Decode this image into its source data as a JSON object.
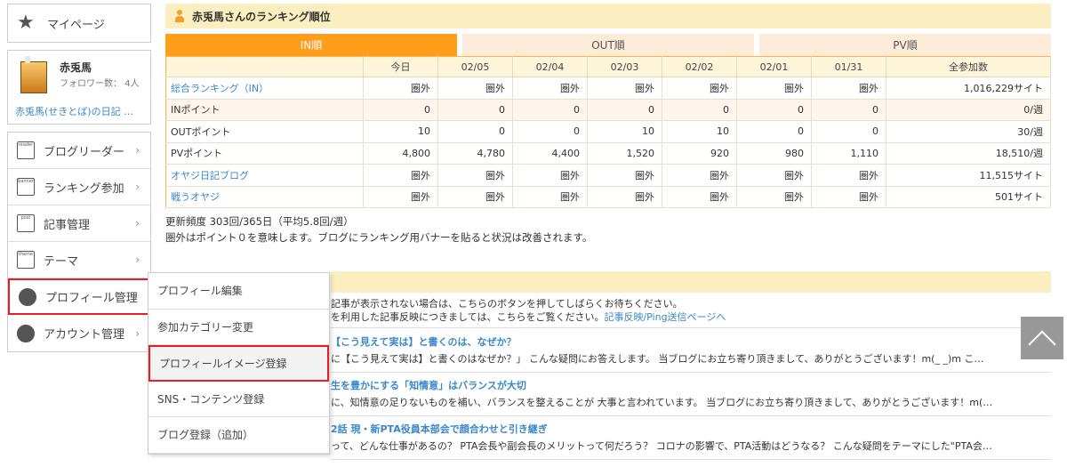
{
  "sidebar": {
    "mypage_label": "マイページ",
    "profile": {
      "name": "赤兎馬",
      "followers": "フォロワー数： 4人",
      "diary": "赤兎馬(せきとば)の日記 …"
    },
    "menu": [
      {
        "label": "ブログリーダー",
        "icon": "reader"
      },
      {
        "label": "ランキング参加",
        "icon": "banner"
      },
      {
        "label": "記事管理",
        "icon": "post"
      },
      {
        "label": "テーマ",
        "icon": "theme"
      },
      {
        "label": "プロフィール管理",
        "icon": "profile"
      },
      {
        "label": "アカウント管理",
        "icon": "gear"
      }
    ]
  },
  "submenu": [
    "プロフィール編集",
    "参加カテゴリー変更",
    "プロフィールイメージ登録",
    "SNS・コンテンツ登録",
    "ブログ登録（追加）"
  ],
  "ranking": {
    "heading": "赤兎馬さんのランキング順位",
    "tabs": [
      "IN順",
      "OUT順",
      "PV順"
    ],
    "columns": [
      "",
      "今日",
      "02/05",
      "02/04",
      "02/03",
      "02/02",
      "02/01",
      "01/31",
      "全参加数"
    ],
    "rows": [
      {
        "label": "総合ランキング（IN）",
        "link": true,
        "cells": [
          "圏外",
          "圏外",
          "圏外",
          "圏外",
          "圏外",
          "圏外",
          "圏外",
          "1,016,229サイト"
        ]
      },
      {
        "label": "INポイント",
        "link": false,
        "cells": [
          "0",
          "0",
          "0",
          "0",
          "0",
          "0",
          "0",
          "0/週"
        ]
      },
      {
        "label": "OUTポイント",
        "link": false,
        "cells": [
          "10",
          "0",
          "0",
          "10",
          "10",
          "0",
          "0",
          "30/週"
        ]
      },
      {
        "label": "PVポイント",
        "link": false,
        "cells": [
          "4,800",
          "4,780",
          "4,400",
          "1,520",
          "920",
          "980",
          "1,110",
          "18,510/週"
        ]
      },
      {
        "label": "オヤジ日記ブログ",
        "link": true,
        "cells": [
          "圏外",
          "圏外",
          "圏外",
          "圏外",
          "圏外",
          "圏外",
          "圏外",
          "11,515サイト"
        ]
      },
      {
        "label": "戦うオヤジ",
        "link": true,
        "cells": [
          "圏外",
          "圏外",
          "圏外",
          "圏外",
          "圏外",
          "圏外",
          "圏外",
          "501サイト"
        ]
      }
    ],
    "note1": "更新頻度 303回/365日（平均5.8回/週）",
    "note2": "圏外はポイント０を意味します。ブログにランキング用バナーを貼ると状況は改善されます。"
  },
  "posts": {
    "info1": "記事が表示されない場合は、こちらのボタンを押してしばらくお待ちください。",
    "info2": "を利用した記事反映につきましては、こちらをご覧ください。",
    "info_link": "記事反映/Ping送信ページへ",
    "entries": [
      {
        "title": "【こう見えて実は】と書くのは、なぜか？",
        "desc": "に【こう見えて実は】と書くのはなぜか？」 こんな疑問にお答えします。 当ブログにお立ち寄り頂きまして、ありがとうございます！m(_ _)m こ…"
      },
      {
        "title": "生を豊かにする「知情意」はバランスが大切",
        "desc": "に、知情意の足りないものを補い、バランスを整えることが 大事と言われています。 当ブログにお立ち寄り頂きまして、ありがとうございます！m(…"
      },
      {
        "title": "2話 現・新PTA役員本部会で顔合わせと引き継ぎ",
        "desc": "って、どんな仕事があるの？ PTA会長や副会長のメリットって何だろう？ コロナの影響で、PTA活動はどうなる？ こんな疑問をテーマにした\"PTA会…"
      }
    ]
  }
}
